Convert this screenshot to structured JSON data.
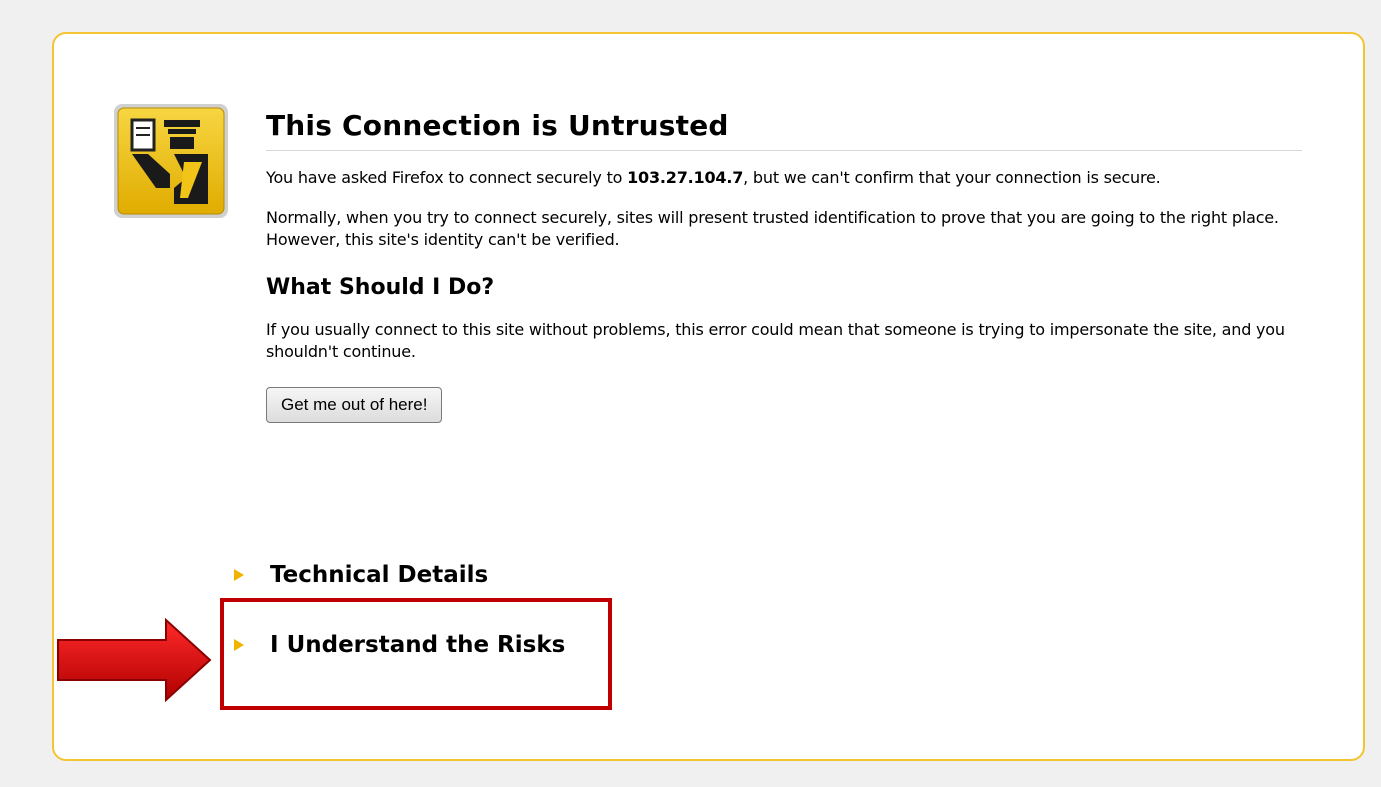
{
  "error": {
    "title": "This Connection is Untrusted",
    "intro_prefix": "You have asked Firefox to connect securely to ",
    "host": "103.27.104.7",
    "intro_suffix": ", but we can't confirm that your connection is secure.",
    "explanation": "Normally, when you try to connect securely, sites will present trusted identification to prove that you are going to the right place. However, this site's identity can't be verified.",
    "what_heading": "What Should I Do?",
    "what_text": "If you usually connect to this site without problems, this error could mean that someone is trying to impersonate the site, and you shouldn't continue.",
    "escape_button_label": "Get me out of here!",
    "technical_details_label": "Technical Details",
    "understand_risks_label": "I Understand the Risks"
  },
  "icons": {
    "main": "security-officer-icon",
    "expander": "triangle-right-icon",
    "annotation": "arrow-right-icon"
  },
  "colors": {
    "card_border": "#f5c432",
    "icon_background": "#f2c417",
    "expander_arrow": "#f0b400",
    "annotation_red": "#c00000"
  }
}
